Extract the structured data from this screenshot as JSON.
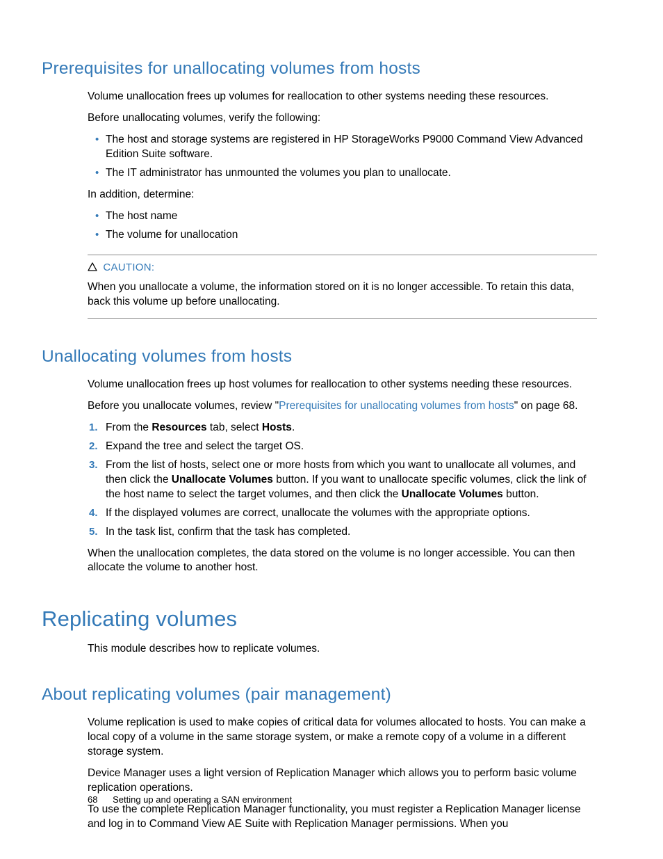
{
  "section1": {
    "heading": "Prerequisites for unallocating volumes from hosts",
    "p1": "Volume unallocation frees up volumes for reallocation to other systems needing these resources.",
    "p2": "Before unallocating volumes, verify the following:",
    "bullets1": [
      "The host and storage systems are registered in HP StorageWorks P9000 Command View Advanced Edition Suite software.",
      "The IT administrator has unmounted the volumes you plan to unallocate."
    ],
    "p3": "In addition, determine:",
    "bullets2": [
      "The host name",
      "The volume for unallocation"
    ],
    "caution_label": "CAUTION:",
    "caution_text": "When you unallocate a volume, the information stored on it is no longer accessible. To retain this data, back this volume up before unallocating."
  },
  "section2": {
    "heading": "Unallocating volumes from hosts",
    "p1": "Volume unallocation frees up host volumes for reallocation to other systems needing these resources.",
    "p2_pre": "Before you unallocate volumes, review \"",
    "p2_link": "Prerequisites for unallocating volumes from hosts",
    "p2_post": "\" on page 68.",
    "step1_a": "From the ",
    "step1_b": "Resources",
    "step1_c": " tab, select ",
    "step1_d": "Hosts",
    "step1_e": ".",
    "step2": "Expand the tree and select the target OS.",
    "step3_a": "From the list of hosts, select one or more hosts from which you want to unallocate all volumes, and then click the ",
    "step3_b": "Unallocate Volumes",
    "step3_c": " button. If you want to unallocate specific volumes, click the link of the host name to select the target volumes, and then click the ",
    "step3_d": "Unallocate Volumes",
    "step3_e": " button.",
    "step4": "If the displayed volumes are correct, unallocate the volumes with the appropriate options.",
    "step5": "In the task list, confirm that the task has completed.",
    "p3": "When the unallocation completes, the data stored on the volume is no longer accessible. You can then allocate the volume to another host."
  },
  "section3": {
    "heading": "Replicating volumes",
    "p1": "This module describes how to replicate volumes."
  },
  "section4": {
    "heading": "About replicating volumes (pair management)",
    "p1": "Volume replication is used to make copies of critical data for volumes allocated to hosts. You can make a local copy of a volume in the same storage system, or make a remote copy of a volume in a different storage system.",
    "p2": "Device Manager uses a light version of Replication Manager which allows you to perform basic volume replication operations.",
    "p3": "To use the complete Replication Manager functionality, you must register a Replication Manager license and log in to Command View AE Suite with Replication Manager permissions. When you"
  },
  "footer": {
    "page": "68",
    "title": "Setting up and operating a SAN environment"
  }
}
